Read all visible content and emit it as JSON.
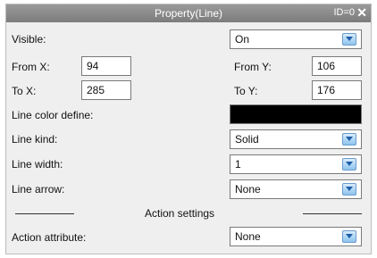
{
  "window": {
    "title": "Property(Line)",
    "id_label": "ID=0",
    "close_glyph": "✕"
  },
  "visible": {
    "label": "Visible:",
    "value": "On"
  },
  "from_x": {
    "label": "From X:",
    "value": "94"
  },
  "from_y": {
    "label": "From Y:",
    "value": "106"
  },
  "to_x": {
    "label": "To X:",
    "value": "285"
  },
  "to_y": {
    "label": "To Y:",
    "value": "176"
  },
  "line_color": {
    "label": "Line color define:",
    "color": "#000000"
  },
  "line_kind": {
    "label": "Line kind:",
    "value": "Solid"
  },
  "line_width": {
    "label": "Line width:",
    "value": "1"
  },
  "line_arrow": {
    "label": "Line arrow:",
    "value": "None"
  },
  "action_settings": {
    "heading": "Action settings"
  },
  "action_attribute": {
    "label": "Action attribute:",
    "value": "None"
  },
  "icons": {
    "dropdown": "chevron-down-icon",
    "close": "close-icon"
  }
}
